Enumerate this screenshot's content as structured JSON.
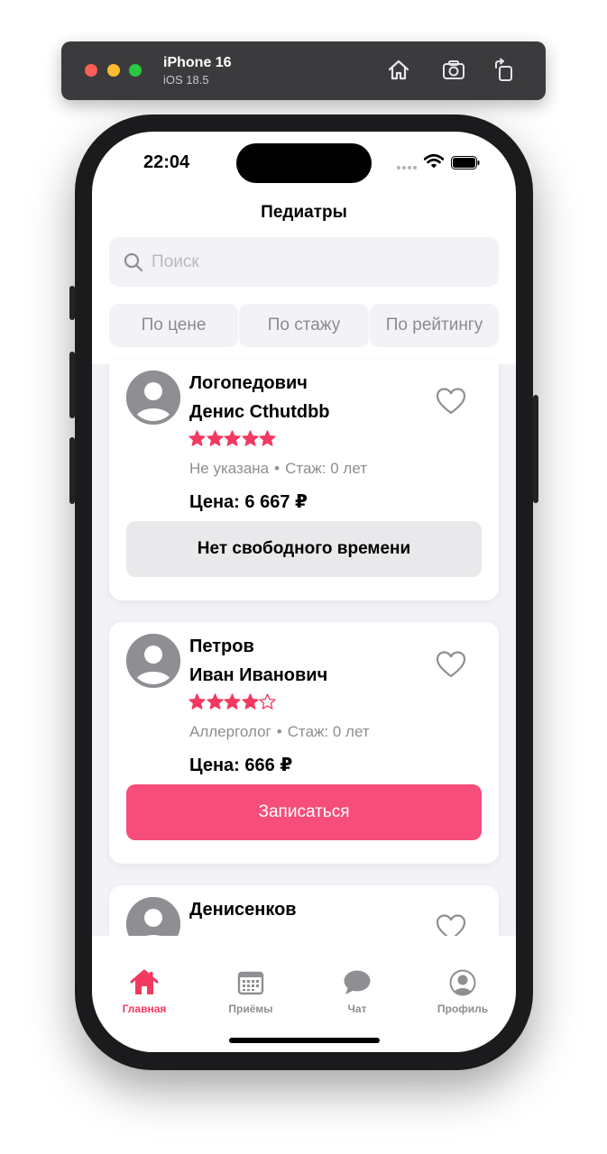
{
  "simulator": {
    "device": "iPhone 16",
    "os": "iOS 18.5",
    "buttons": [
      "home-icon",
      "screenshot-icon",
      "rotate-icon"
    ]
  },
  "status_bar": {
    "time": "22:04"
  },
  "header": {
    "title": "Педиатры"
  },
  "search": {
    "placeholder": "Поиск",
    "value": ""
  },
  "sort": {
    "options": [
      "По цене",
      "По стажу",
      "По рейтингу"
    ]
  },
  "colors": {
    "accent": "#f64d7a",
    "star": "#f2395f",
    "muted": "#8e8e93",
    "bg": "#f2f2f7"
  },
  "doctors": [
    {
      "last_name": "Логопедович",
      "first_name": "Денис Cthutdbb",
      "rating": 5,
      "specialty": "Не указана",
      "separator": "•",
      "experience": "Стаж: 0 лет",
      "price": "Цена: 6 667 ₽",
      "action": "Нет свободного времени",
      "action_state": "disabled"
    },
    {
      "last_name": "Петров",
      "first_name": "Иван Иванович",
      "rating": 4,
      "specialty": "Аллерголог",
      "separator": "•",
      "experience": "Стаж: 0 лет",
      "price": "Цена: 666 ₽",
      "action": "Записаться",
      "action_state": "enabled"
    },
    {
      "last_name": "Денисенков"
    }
  ],
  "tabbar": {
    "items": [
      {
        "label": "Главная",
        "icon": "home-icon",
        "active": true
      },
      {
        "label": "Приёмы",
        "icon": "calendar-icon",
        "active": false
      },
      {
        "label": "Чат",
        "icon": "chat-bubble-icon",
        "active": false
      },
      {
        "label": "Профиль",
        "icon": "profile-icon",
        "active": false
      }
    ]
  }
}
